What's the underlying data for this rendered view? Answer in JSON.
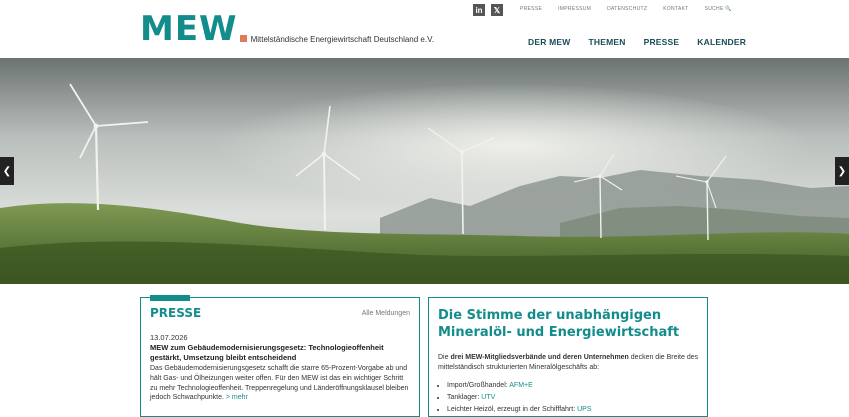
{
  "header": {
    "logo_text": "MEW",
    "logo_subtitle": "Mittelständische Energiewirtschaft Deutschland e.V.",
    "social": [
      {
        "icon": "linkedin-icon",
        "glyph": "in"
      },
      {
        "icon": "x-icon",
        "glyph": "𝕏"
      }
    ],
    "top_nav": [
      "PRESSE",
      "IMPRESSUM",
      "DATENSCHUTZ",
      "KONTAKT",
      "SUCHE"
    ],
    "search_glyph": "🔍",
    "main_nav": [
      "DER MEW",
      "THEMEN",
      "PRESSE",
      "KALENDER"
    ]
  },
  "hero": {
    "prev_glyph": "❮",
    "next_glyph": "❯"
  },
  "presse": {
    "title": "PRESSE",
    "all_link": "Alle Meldungen",
    "date": "13.07.2026",
    "headline": "MEW zum Gebäudemodernisierungsgesetz: Technologieoffenheit gestärkt, Umsetzung bleibt entscheidend",
    "body": "Das Gebäudemodernisierungsgesetz schafft die starre 65-Prozent-Vorgabe ab und hält Gas- und Ölheizungen weiter offen. Für den MEW ist das ein wichtiger Schritt zu mehr Technologieoffenheit. Treppenregelung und Länderöffnungsklausel bleiben jedoch Schwachpunkte.",
    "more": "> mehr"
  },
  "stimme": {
    "title": "Die Stimme der unabhängigen Mineralöl- und Energiewirtschaft",
    "text_pre": "Die ",
    "text_bold": "drei MEW-Mitgliedsverbände und deren Unternehmen",
    "text_post": " decken die Breite des mittelständisch strukturierten Mineralölgeschäfts ab:",
    "items": [
      {
        "label": "Import/Großhandel: ",
        "link": "AFM+E"
      },
      {
        "label": "Tanklager: ",
        "link": "UTV"
      },
      {
        "label": "Leichter Heizöl, erzeugt in der Schifffahrt: ",
        "link": "UPS"
      }
    ]
  },
  "colors": {
    "brand_teal": "#138c8c",
    "nav_dark": "#1a4a5c",
    "accent_orange": "#e07a5f"
  }
}
